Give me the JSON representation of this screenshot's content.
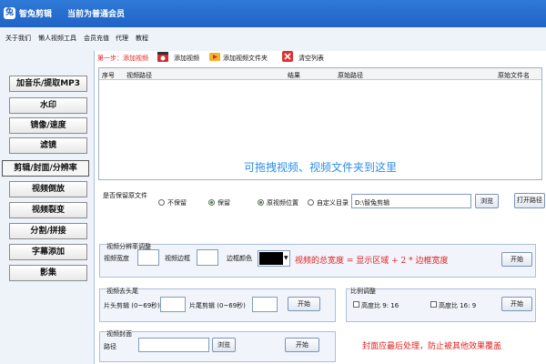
{
  "titlebar": {
    "app_name": "智兔剪辑",
    "member_status": "当前为普通会员"
  },
  "menu": [
    "关于我们",
    "懒人视频工具",
    "会员充值",
    "代理",
    "教程"
  ],
  "sidebar": [
    {
      "label": "加音乐/提取MP3"
    },
    {
      "label": "水印"
    },
    {
      "label": "镜像/速度"
    },
    {
      "label": "滤镜"
    },
    {
      "label": "剪辑/封面/分辨率"
    },
    {
      "label": "视频倒放"
    },
    {
      "label": "视频裂变"
    },
    {
      "label": "分割/拼接"
    },
    {
      "label": "字幕添加"
    },
    {
      "label": "影集"
    }
  ],
  "toolbar": {
    "step1": "第一步：添加视频",
    "add_video": "添加视频",
    "add_folder": "添加视频文件夹",
    "clear_list": "清空列表"
  },
  "table": {
    "columns": [
      "序号",
      "视频路径",
      "结果",
      "原始路径",
      "原始文件名"
    ],
    "empty_hint": "可拖拽视频、视频文件夹到这里"
  },
  "save_original": {
    "label": "是否保留原文件",
    "options": [
      "不保留",
      "保留"
    ],
    "selected": "保留"
  },
  "output": {
    "options": [
      "原视频位置",
      "自定义目录"
    ],
    "selected": "原视频位置",
    "path": "D:\\智兔剪辑",
    "browse": "浏览",
    "open_path": "打开路径"
  },
  "resolution": {
    "title": "视频分辨率调整",
    "width_label": "视频宽度",
    "border_label": "视频边框",
    "border_color_label": "边框颜色",
    "border_color": "#000000",
    "note": "视频的总宽度 = 显示区域 + 2 * 边框宽度",
    "start": "开始"
  },
  "trim": {
    "title": "视频去头尾",
    "head_label": "片头剪辑 (0~69秒)",
    "tail_label": "片尾剪辑 (0~69秒)",
    "start": "开始"
  },
  "ratio": {
    "title": "比例调整",
    "options": [
      "高度比 9: 16",
      "高度比 16: 9"
    ],
    "start": "开始"
  },
  "cover": {
    "title": "视频封面",
    "path_label": "路径",
    "browse": "浏览",
    "start": "开始",
    "note": "封面应最后处理，防止被其他效果覆盖"
  }
}
